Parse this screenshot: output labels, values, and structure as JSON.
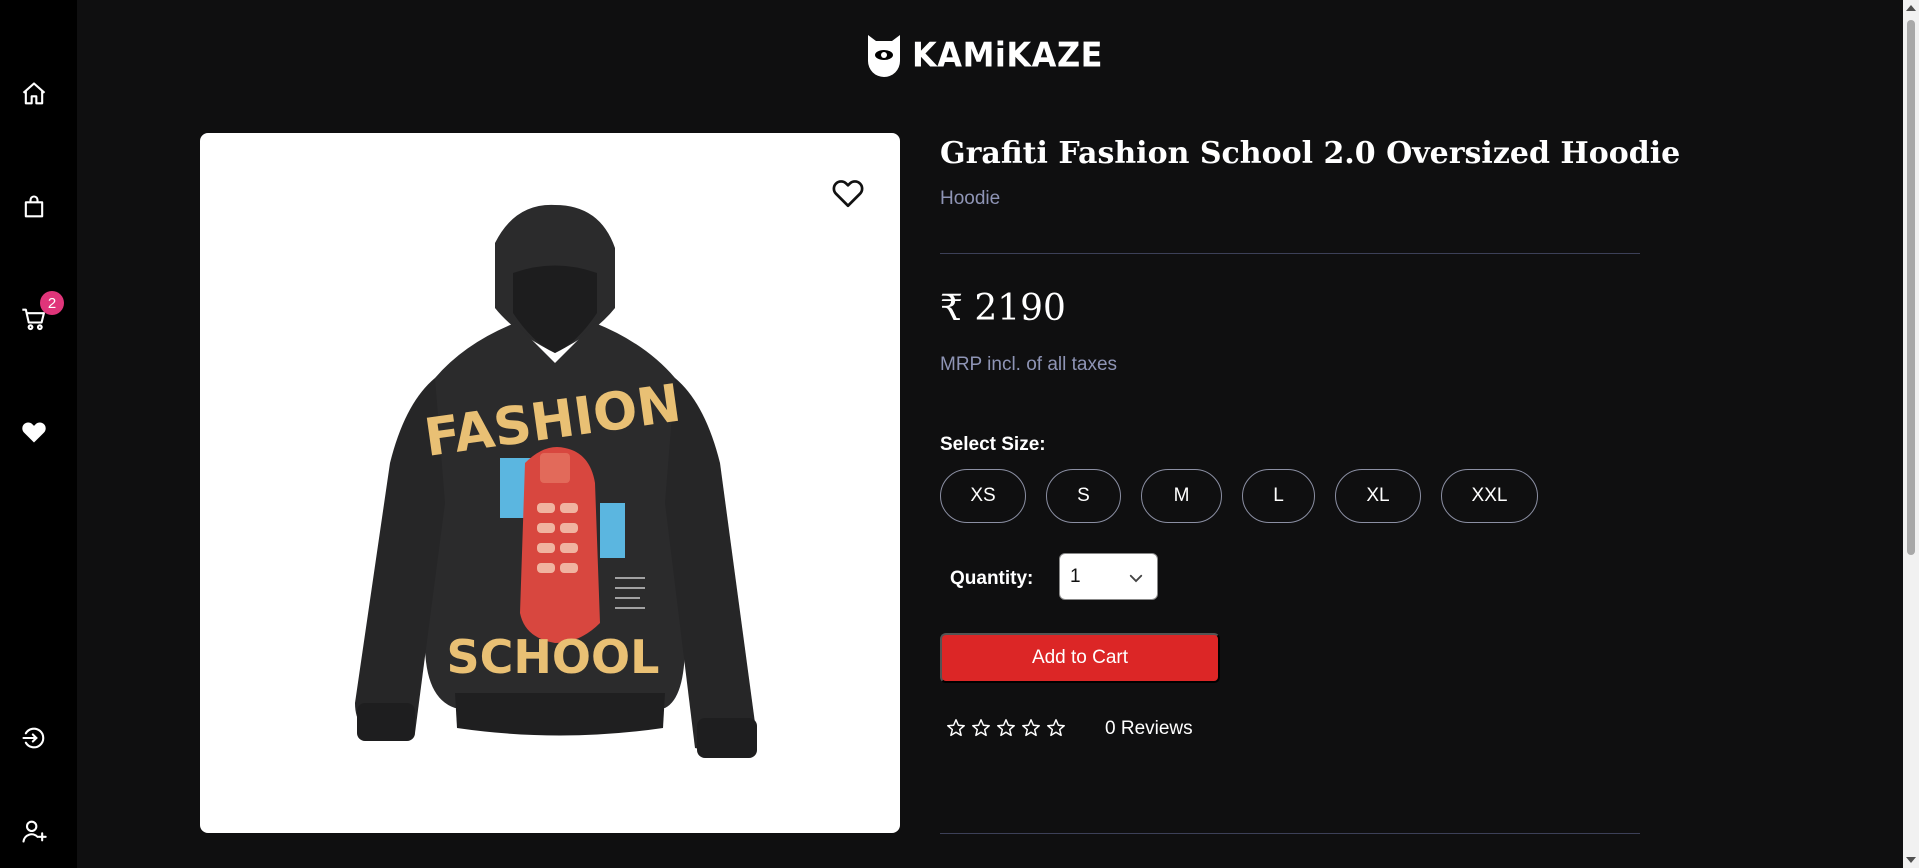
{
  "brand": {
    "name": "KAMiKAZE"
  },
  "sidebar": {
    "items": [
      {
        "icon": "home-icon"
      },
      {
        "icon": "shopping-bag-icon"
      },
      {
        "icon": "cart-icon",
        "badge": "2"
      },
      {
        "icon": "heart-icon"
      },
      {
        "icon": "login-icon"
      },
      {
        "icon": "add-user-icon"
      }
    ]
  },
  "product": {
    "title": "Grafiti Fashion School 2.0 Oversized Hoodie",
    "category": "Hoodie",
    "price": "₹ 2190",
    "mrp_note": "MRP incl. of all taxes",
    "size_label": "Select Size:",
    "sizes": [
      "XS",
      "S",
      "M",
      "L",
      "XL",
      "XXL"
    ],
    "quantity_label": "Quantity:",
    "quantity_value": "1",
    "add_to_cart_label": "Add to Cart",
    "rating": 0,
    "reviews_label": "0 Reviews",
    "image_print": {
      "top": "FASHION",
      "bottom": "SCHOOL"
    }
  },
  "colors": {
    "background": "#0f0f10",
    "sidebar": "#000000",
    "accent_red": "#dc2626",
    "badge_pink": "#e0357a",
    "muted_text": "#8e94b5"
  }
}
